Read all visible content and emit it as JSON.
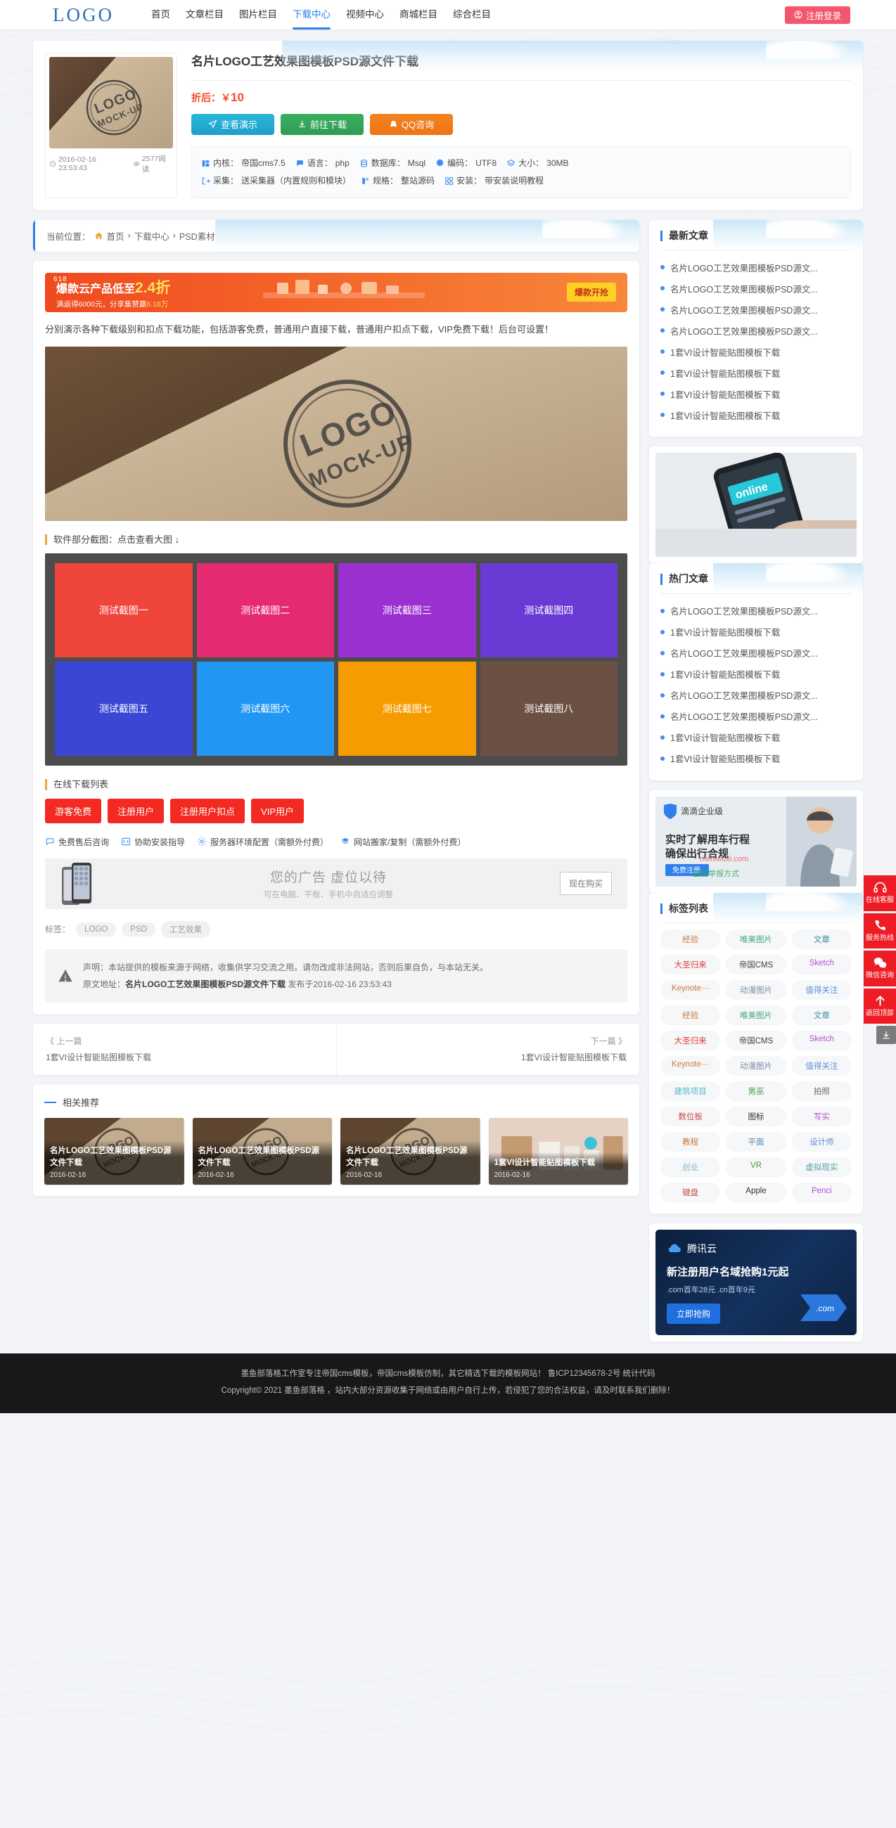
{
  "header": {
    "logo": "LOGO",
    "nav": [
      {
        "label": "首页",
        "active": false
      },
      {
        "label": "文章栏目",
        "active": false
      },
      {
        "label": "图片栏目",
        "active": false
      },
      {
        "label": "下载中心",
        "active": true
      },
      {
        "label": "视频中心",
        "active": false
      },
      {
        "label": "商城栏目",
        "active": false
      },
      {
        "label": "综合栏目",
        "active": false
      }
    ],
    "login_label": "注册登录"
  },
  "detail": {
    "title": "名片LOGO工艺效果图模板PSD源文件下载",
    "price_label": "折后：",
    "price_symbol": "￥",
    "price_value": "10",
    "publish_date": "2016-02-16 23:53:43",
    "views": "2577阅读",
    "buttons": [
      {
        "label": "查看演示",
        "icon": "paper-plane-icon",
        "style": "demo"
      },
      {
        "label": "前往下载",
        "icon": "download-icon",
        "style": "download"
      },
      {
        "label": "QQ咨询",
        "icon": "qq-icon",
        "style": "qq"
      }
    ],
    "specs_row1": [
      {
        "icon": "core-icon",
        "label": "内核：",
        "value": "帝国cms7.5"
      },
      {
        "icon": "language-icon",
        "label": "语言：",
        "value": "php"
      },
      {
        "icon": "database-icon",
        "label": "数据库：",
        "value": "Msql"
      },
      {
        "icon": "gear-icon",
        "label": "编码：",
        "value": "UTF8"
      },
      {
        "icon": "layers-icon",
        "label": "大小：",
        "value": "30MB"
      }
    ],
    "specs_row2": [
      {
        "icon": "export-icon",
        "label": "采集：",
        "value": "送采集器（内置规则和模块）"
      },
      {
        "icon": "package-icon",
        "label": "规格：",
        "value": "整站源码"
      },
      {
        "icon": "grid-icon",
        "label": "安装：",
        "value": "带安装说明教程"
      }
    ]
  },
  "breadcrumb": {
    "prefix": "当前位置：",
    "home_icon": "home-icon",
    "items": [
      "首页",
      "下载中心",
      "PSD素材"
    ],
    "separator": "›"
  },
  "promo": {
    "badge": "618",
    "headline_pre": "爆款云产品低至",
    "headline_big": "2.4折",
    "sub_pre": "满返得6000元，分享集赞赢",
    "sub_hl": "6.18万",
    "button": "爆款开抢"
  },
  "article": {
    "paragraph": "分别演示各种下载级别和扣点下载功能，包括游客免费，普通用户直接下载，普通用户扣点下载，VIP免费下载！后台可设置！",
    "screenshot_title": "软件部分截图：点击查看大图 ↓",
    "screenshots": [
      {
        "label": "测试截图一",
        "color": "#f0453a"
      },
      {
        "label": "测试截图二",
        "color": "#e62a72"
      },
      {
        "label": "测试截图三",
        "color": "#9b30d0"
      },
      {
        "label": "测试截图四",
        "color": "#6a3bd4"
      },
      {
        "label": "测试截图五",
        "color": "#3a46d4"
      },
      {
        "label": "测试截图六",
        "color": "#2196f3"
      },
      {
        "label": "测试截图七",
        "color": "#f79c00"
      },
      {
        "label": "测试截图八",
        "color": "#6d5044"
      }
    ]
  },
  "download": {
    "title": "在线下载列表",
    "buttons": [
      "游客免费",
      "注册用户",
      "注册用户扣点",
      "VIP用户"
    ],
    "services": [
      {
        "icon": "chat-icon",
        "label": "免费售后咨询"
      },
      {
        "icon": "code-icon",
        "label": "协助安装指导"
      },
      {
        "icon": "gear-icon",
        "label": "服务器环境配置（需额外付费）"
      },
      {
        "icon": "move-icon",
        "label": "网站搬家/复制（需额外付费）"
      }
    ]
  },
  "ad_inline": {
    "icon": "phone-icon",
    "title": "您的广告 虚位以待",
    "subtitle": "可在电脑、平板、手机中自适应调整",
    "button": "现在购买"
  },
  "tags_inline": {
    "label": "标签：",
    "items": [
      "LOGO",
      "PSD",
      "工艺效果"
    ]
  },
  "statement": {
    "icon": "warning-icon",
    "line1": "声明：本站提供的模板来源于网络，收集供学习交流之用。请勿改成非法网站，否则后果自负，与本站无关。",
    "line2_label": "原文地址：",
    "line2_link": "名片LOGO工艺效果图模板PSD源文件下载",
    "line2_suffix": "发布于2016-02-16 23:53:43"
  },
  "pagination": {
    "prev_label": "《 上一篇",
    "prev_title": "1套VI设计智能贴图模板下载",
    "next_label": "下一篇 》",
    "next_title": "1套VI设计智能贴图模板下载"
  },
  "related": {
    "title": "相关推荐",
    "items": [
      {
        "name": "名片LOGO工艺效果图模板PSD源文件下载",
        "date": "2016-02-16",
        "kind": "logo"
      },
      {
        "name": "名片LOGO工艺效果图模板PSD源文件下载",
        "date": "2016-02-16",
        "kind": "logo"
      },
      {
        "name": "名片LOGO工艺效果图模板PSD源文件下载",
        "date": "2016-02-16",
        "kind": "logo"
      },
      {
        "name": "1套VI设计智能贴图模板下载",
        "date": "2016-02-16",
        "kind": "vi"
      }
    ]
  },
  "sidebar": {
    "latest": {
      "title": "最新文章",
      "items": [
        "名片LOGO工艺效果图模板PSD源文...",
        "名片LOGO工艺效果图模板PSD源文...",
        "名片LOGO工艺效果图模板PSD源文...",
        "名片LOGO工艺效果图模板PSD源文...",
        "1套VI设计智能贴图模板下载",
        "1套VI设计智能贴图模板下载",
        "1套VI设计智能贴图模板下载",
        "1套VI设计智能贴图模板下载"
      ]
    },
    "hot": {
      "title": "热门文章",
      "items": [
        "名片LOGO工艺效果图模板PSD源文...",
        "1套VI设计智能贴图模板下载",
        "名片LOGO工艺效果图模板PSD源文...",
        "1套VI设计智能贴图模板下载",
        "名片LOGO工艺效果图模板PSD源文...",
        "名片LOGO工艺效果图模板PSD源文...",
        "1套VI设计智能贴图模板下载",
        "1套VI设计智能贴图模板下载"
      ]
    },
    "phone_ad": {
      "alt": "online-phone-banner"
    },
    "didi_ad": {
      "brand": "滴滴企业级",
      "headline": "实时了解用车行程",
      "subline": "确保出行合规",
      "button": "免费注册",
      "watermark1": "mimiwuxi.com",
      "watermark2": "盗图举报方式"
    },
    "tags": {
      "title": "标签列表",
      "items": [
        {
          "label": "经验",
          "color": "#c9793f"
        },
        {
          "label": "唯美图片",
          "color": "#3fa87a"
        },
        {
          "label": "文章",
          "color": "#3f8fa8"
        },
        {
          "label": "大圣归来",
          "color": "#e03b3b"
        },
        {
          "label": "帝国CMS",
          "color": "#444444"
        },
        {
          "label": "Sketch",
          "color": "#b44fd8"
        },
        {
          "label": "Keynote···",
          "color": "#c9793f"
        },
        {
          "label": "动漫图片",
          "color": "#7a8fa8"
        },
        {
          "label": "值得关注",
          "color": "#5b8fd8"
        },
        {
          "label": "经验",
          "color": "#c9793f"
        },
        {
          "label": "唯美图片",
          "color": "#3fa87a"
        },
        {
          "label": "文章",
          "color": "#3f8fa8"
        },
        {
          "label": "大圣归来",
          "color": "#e03b3b"
        },
        {
          "label": "帝国CMS",
          "color": "#444444"
        },
        {
          "label": "Sketch",
          "color": "#b44fd8"
        },
        {
          "label": "Keynote···",
          "color": "#c9793f"
        },
        {
          "label": "动漫图片",
          "color": "#7a8fa8"
        },
        {
          "label": "值得关注",
          "color": "#5b8fd8"
        },
        {
          "label": "建筑项目",
          "color": "#55b6c9"
        },
        {
          "label": "男巫",
          "color": "#4a9b4a"
        },
        {
          "label": "拍照",
          "color": "#6b6b6b"
        },
        {
          "label": "数位板",
          "color": "#c94a4a"
        },
        {
          "label": "图标",
          "color": "#333333"
        },
        {
          "label": "写实",
          "color": "#b44fd8"
        },
        {
          "label": "教程",
          "color": "#c9793f"
        },
        {
          "label": "平面",
          "color": "#5a8fb0"
        },
        {
          "label": "设计师",
          "color": "#5b8fd8"
        },
        {
          "label": "创业",
          "color": "#7fb8c9"
        },
        {
          "label": "VR",
          "color": "#4a9b4a"
        },
        {
          "label": "虚拟现实",
          "color": "#55a0a0"
        },
        {
          "label": "键盘",
          "color": "#c94a4a"
        },
        {
          "label": "Apple",
          "color": "#333333"
        },
        {
          "label": "Penci",
          "color": "#b44fd8"
        }
      ]
    },
    "tencent_ad": {
      "brand": "腾讯云",
      "headline": "新注册用户名域抢购1元起",
      "subline": ".com首年28元 .cn首年9元",
      "button": "立即抢购",
      "badge": ".com"
    }
  },
  "floatbar": [
    {
      "icon": "headset-icon",
      "label": "在线客服"
    },
    {
      "icon": "phone-ring-icon",
      "label": "服务热线"
    },
    {
      "icon": "wechat-icon",
      "label": "微信咨询"
    },
    {
      "icon": "arrow-up-icon",
      "label": "返回顶部"
    }
  ],
  "floatbar_extra": {
    "icon": "download-small-icon"
  },
  "footer": {
    "line1": "墨鱼部落格工作室专注帝国cms模板，帝国cms模板仿制，其它精选下载的模板网站！ 鲁ICP12345678-2号 统计代码",
    "line2": "Copyright© 2021  墨鱼部落格 ，站内大部分资源收集于网络或由用户自行上传，若侵犯了您的合法权益，请及时联系我们删除！"
  }
}
